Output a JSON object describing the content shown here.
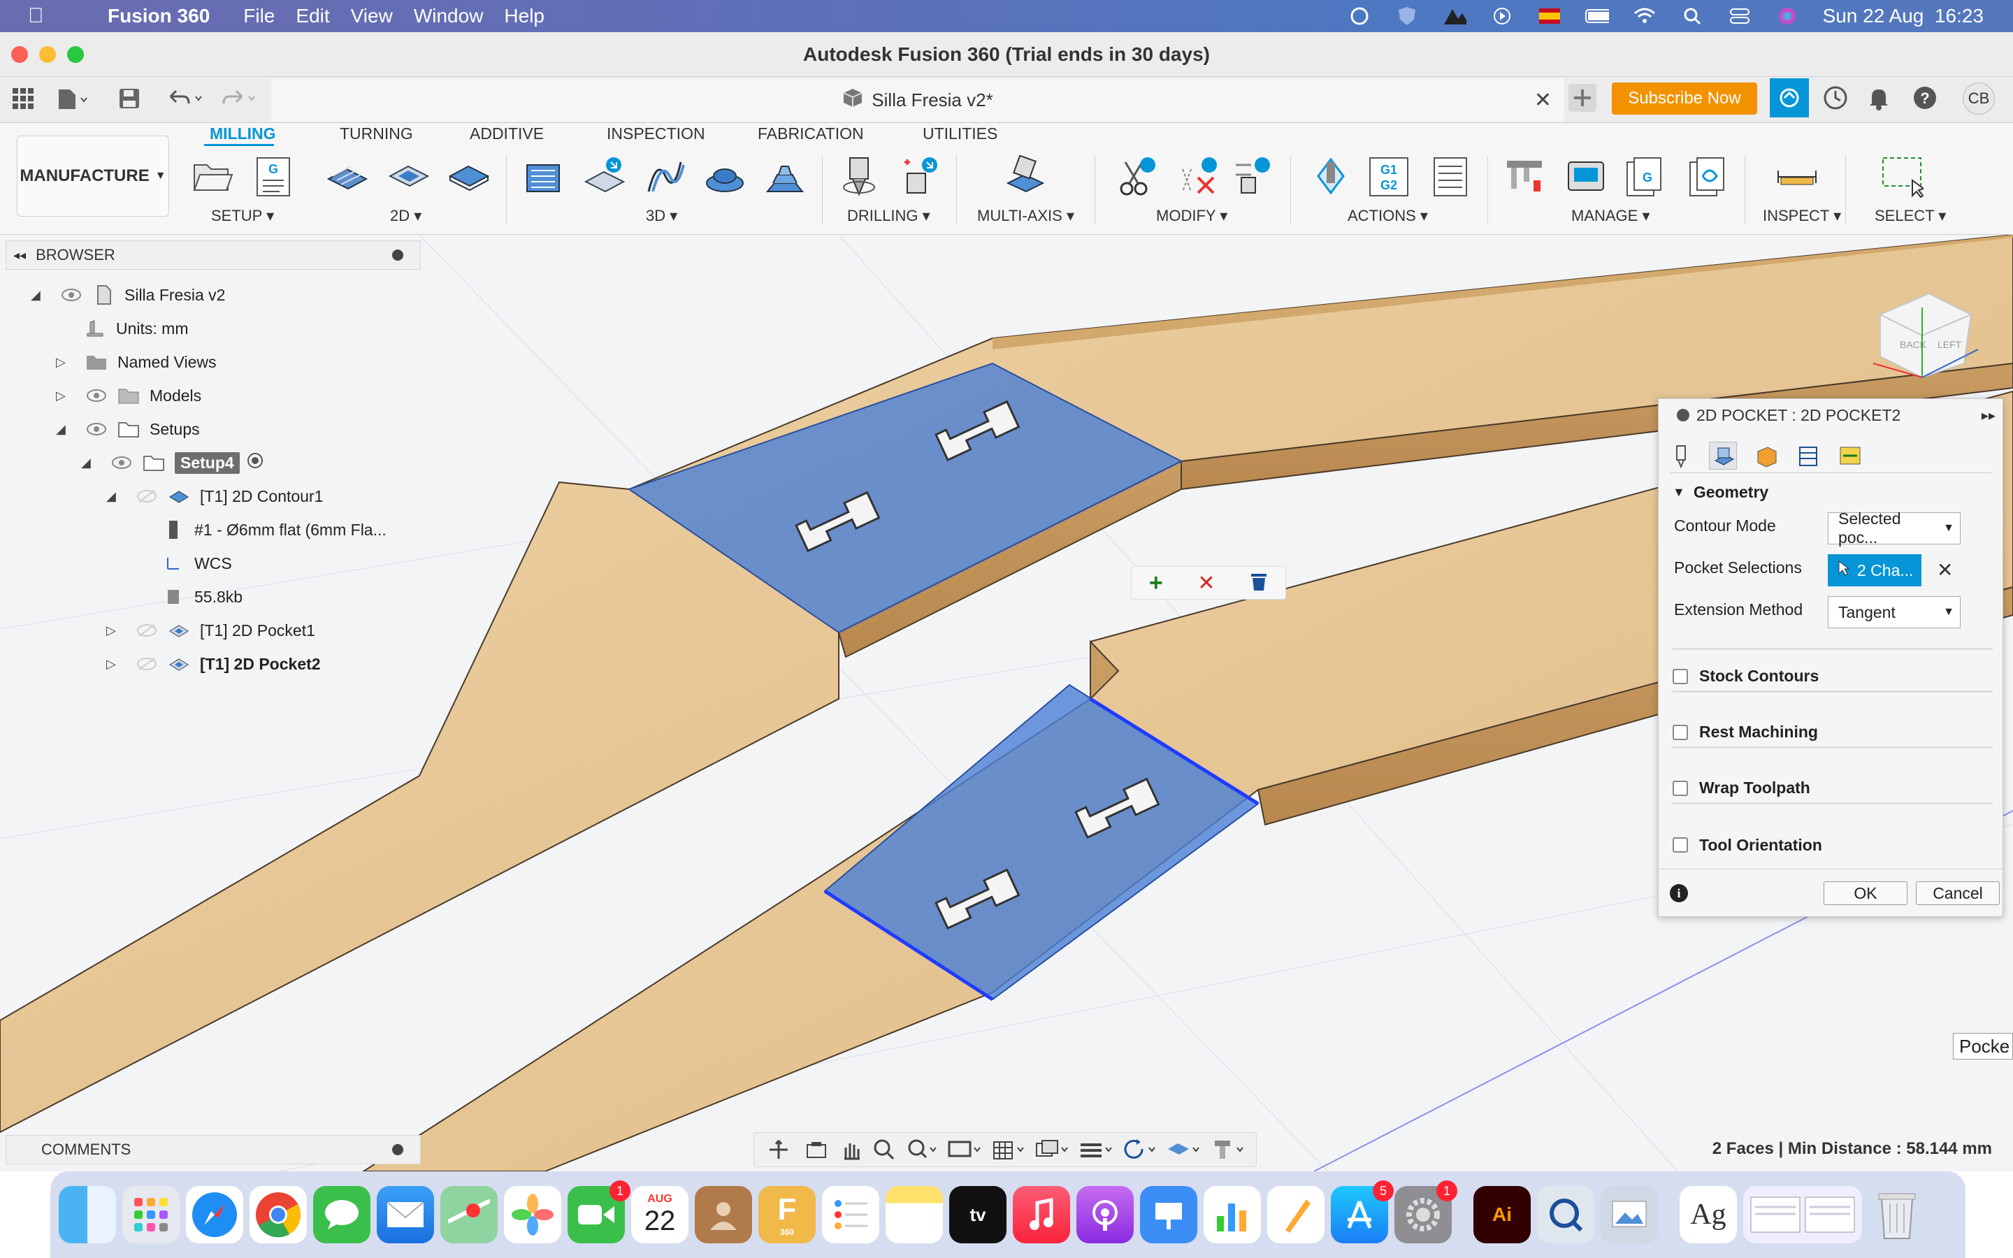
{
  "menubar": {
    "app_name": "Fusion 360",
    "menus": [
      "File",
      "Edit",
      "View",
      "Window",
      "Help"
    ],
    "datetime": "Sun 22 Aug  16:23"
  },
  "window": {
    "title": "Autodesk Fusion 360 (Trial ends in 30 days)",
    "doc_tab": "Silla Fresia v2*",
    "subscribe_label": "Subscribe Now",
    "user_initials": "CB"
  },
  "toolbar": {
    "workspace": "MANUFACTURE",
    "tabs": [
      "MILLING",
      "TURNING",
      "ADDITIVE",
      "INSPECTION",
      "FABRICATION",
      "UTILITIES"
    ],
    "groups": {
      "setup": "SETUP",
      "twod": "2D",
      "threed": "3D",
      "drilling": "DRILLING",
      "multiaxis": "MULTI-AXIS",
      "modify": "MODIFY",
      "actions": "ACTIONS",
      "manage": "MANAGE",
      "inspect": "INSPECT",
      "select": "SELECT"
    },
    "g1g2_label": "G1\nG2"
  },
  "browser": {
    "title": "BROWSER",
    "nodes": {
      "root": "Silla Fresia v2",
      "units": "Units: mm",
      "named_views": "Named Views",
      "models": "Models",
      "setups": "Setups",
      "setup4": "Setup4",
      "contour1": "[T1] 2D Contour1",
      "tool": "#1 - Ø6mm flat (6mm Fla...",
      "wcs": "WCS",
      "size": "55.8kb",
      "pocket1": "[T1] 2D Pocket1",
      "pocket2": "[T1] 2D Pocket2"
    }
  },
  "dialog": {
    "title": "2D POCKET : 2D POCKET2",
    "geometry_section": "Geometry",
    "contour_mode_label": "Contour Mode",
    "contour_mode_value": "Selected poc...",
    "pocket_selections_label": "Pocket Selections",
    "pocket_selections_value": "2 Cha...",
    "extension_method_label": "Extension Method",
    "extension_method_value": "Tangent",
    "stock_contours": "Stock Contours",
    "rest_machining": "Rest Machining",
    "wrap_toolpath": "Wrap Toolpath",
    "tool_orientation": "Tool Orientation",
    "ok_label": "OK",
    "cancel_label": "Cancel"
  },
  "viewcube": {
    "back": "BACK",
    "left": "LEFT"
  },
  "tooltip": "Pocke",
  "comments": "COMMENTS",
  "status": "2 Faces | Min Distance : 58.144 mm",
  "dock": {
    "calendar_month": "AUG",
    "calendar_day": "22",
    "facetime_badge": "1",
    "appstore_badge": "5",
    "settings_badge": "1",
    "illustrator": "Ai",
    "tv": "tv",
    "font_book": "Ag",
    "fusion_label": "360"
  },
  "colors": {
    "accent": "#0696d7",
    "subscribe": "#f39200",
    "selection_blue": "#4a7fd6",
    "wood": "#e6c79a"
  }
}
